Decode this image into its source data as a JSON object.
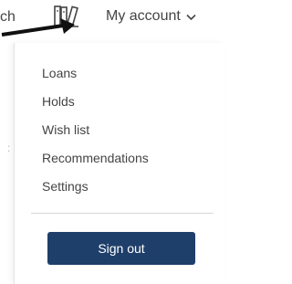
{
  "header": {
    "search_fragment": "ch",
    "account_label": "My account",
    "icons": {
      "shelf": "bookshelf-icon",
      "chevron": "chevron-down-icon"
    }
  },
  "annotation": {
    "arrow": "black-pointer-arrow"
  },
  "menu": {
    "items": [
      {
        "label": "Loans"
      },
      {
        "label": "Holds"
      },
      {
        "label": "Wish list"
      },
      {
        "label": "Recommendations"
      },
      {
        "label": "Settings"
      }
    ],
    "signout_label": "Sign out"
  },
  "colors": {
    "primary_button": "#1f3f6b",
    "text": "#444444",
    "divider": "#d8d8d8"
  }
}
